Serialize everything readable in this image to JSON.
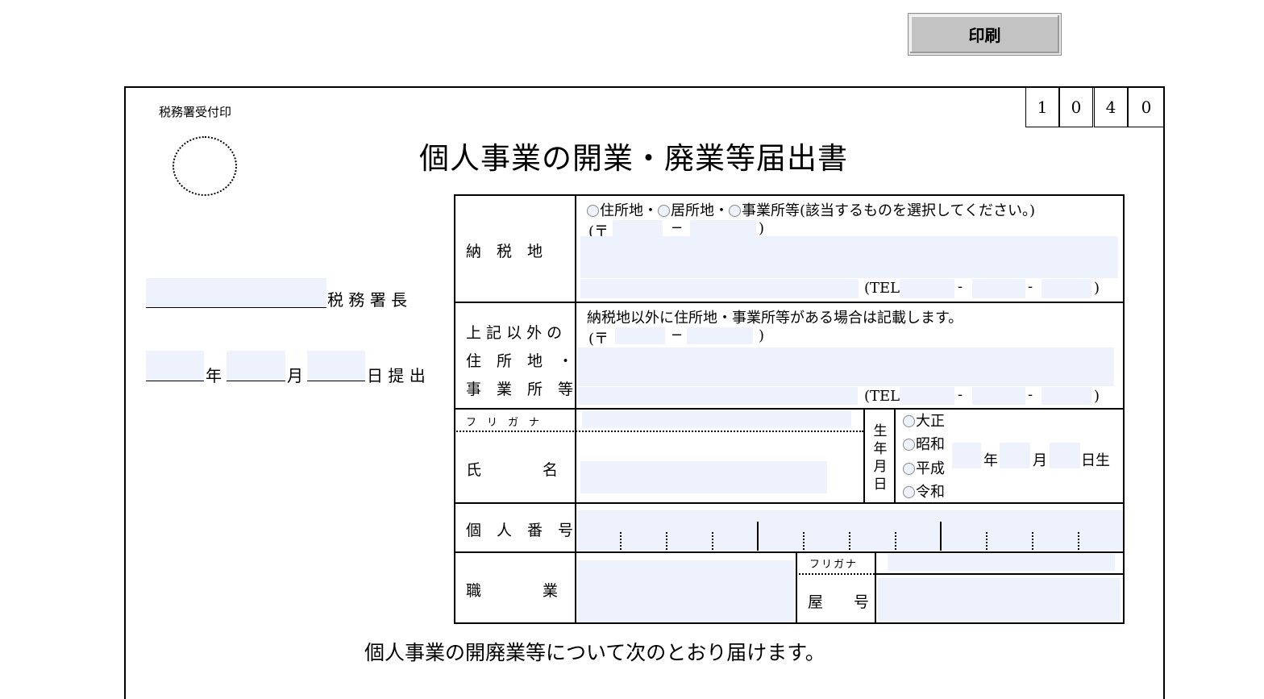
{
  "print_button": "印刷",
  "stamp_label": "税務署受付印",
  "code_digits": [
    "1",
    "0",
    "4",
    "0"
  ],
  "title": "個人事業の開業・廃業等届出書",
  "office_suffix": "税 務 署 長",
  "date": {
    "year": "年",
    "month": "月",
    "day_submit": "日 提 出"
  },
  "tax_address": {
    "label": "納　税　地",
    "options": [
      "住所地",
      "居所地",
      "事業所等"
    ],
    "option_note": "(該当するものを選択してください。)",
    "postal_open": "(〒",
    "dash": "−",
    "close": ")",
    "tel": "(TEL",
    "tel_dash": "-",
    "tel_close": ")"
  },
  "other_address": {
    "label_lines": [
      "上 記 以 外 の",
      "住　所　地　・",
      "事　業　所　等"
    ],
    "note": "納税地以外に住所地・事業所等がある場合は記載します。",
    "postal_open": "(〒",
    "dash": "−",
    "close": ")",
    "tel": "(TEL",
    "tel_dash": "-",
    "tel_close": ")"
  },
  "name": {
    "furigana_label": "フ　リ　ガ　ナ",
    "label": "氏　　　　名",
    "birth_label_chars": [
      "生",
      "年",
      "月",
      "日"
    ],
    "eras": [
      "大正",
      "昭和",
      "平成",
      "令和"
    ],
    "year": "年",
    "month": "月",
    "day": "日生"
  },
  "my_number": {
    "label": "個　人　番　号"
  },
  "occupation": {
    "label": "職　　　　業",
    "furigana_label": "フリガナ",
    "trade_name_label": "屋　　号"
  },
  "footer_text": "個人事業の開廃業等について次のとおり届けます。"
}
